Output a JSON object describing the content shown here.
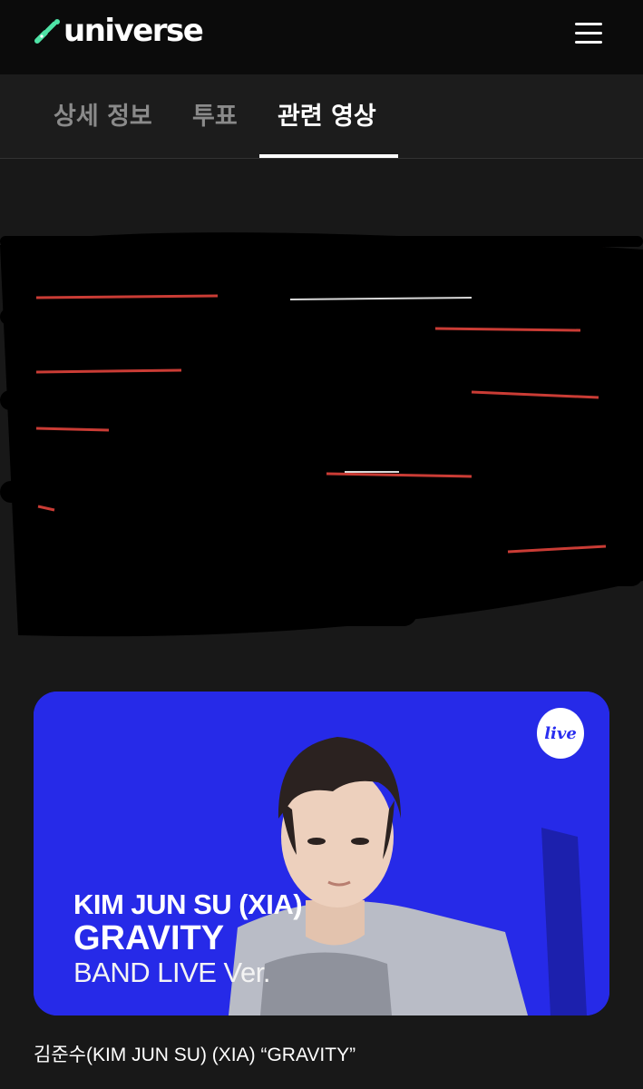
{
  "header": {
    "logo_text": "universe",
    "logo_icon": "universe-logo-icon",
    "menu_icon": "hamburger-menu-icon"
  },
  "tabs": [
    {
      "label": "상세 정보",
      "active": false
    },
    {
      "label": "투표",
      "active": false
    },
    {
      "label": "관련 영상",
      "active": true
    }
  ],
  "video": {
    "thumbnail_line1": "KIM JUN SU (XIA)",
    "thumbnail_line2": "GRAVITY",
    "thumbnail_line3": "BAND LIVE Ver.",
    "badge_text": "live",
    "caption": "김준수(KIM JUN SU) (XIA) “GRAVITY”"
  },
  "colors": {
    "background": "#181818",
    "header_bg": "#0b0b0b",
    "tab_inactive": "#8a8a8a",
    "tab_active": "#ffffff",
    "brand_green": "#4fe3a6",
    "thumbnail_blue": "#2a2ef0",
    "redaction_red": "#e0433b"
  }
}
